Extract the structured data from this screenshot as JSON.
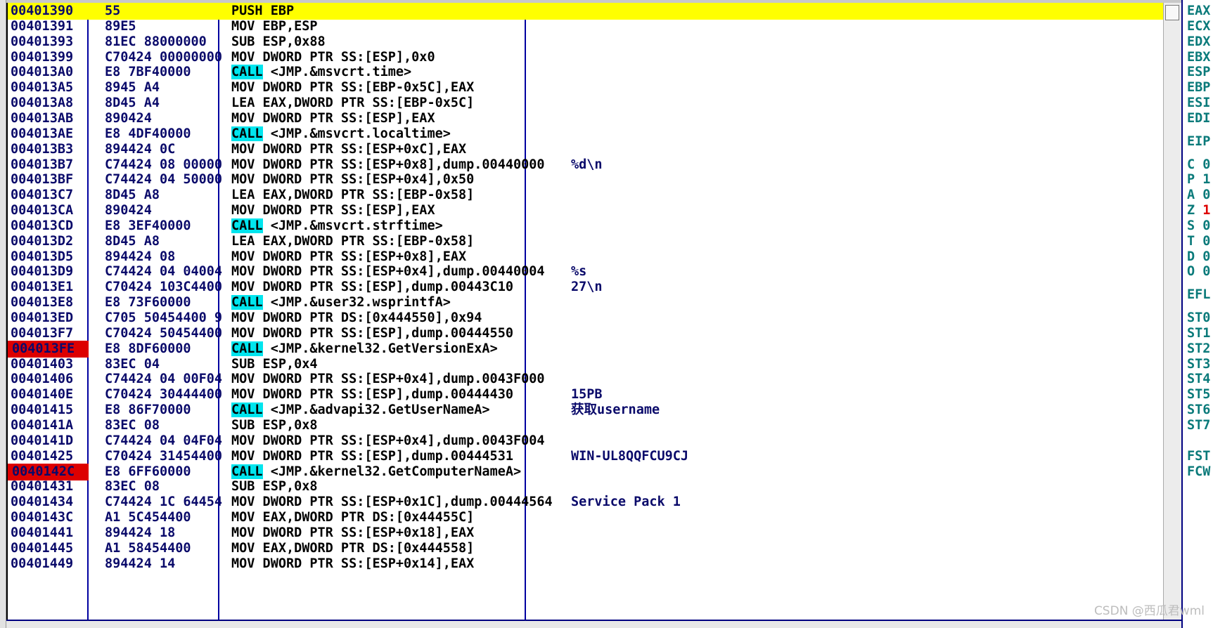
{
  "rows": [
    {
      "addr": "00401390",
      "hex": "55",
      "mnem": "PUSH EBP",
      "args": "",
      "comment": "",
      "selected": true,
      "breakpoint": false
    },
    {
      "addr": "00401391",
      "hex": "89E5",
      "mnem": "MOV EBP,ESP",
      "args": "",
      "comment": ""
    },
    {
      "addr": "00401393",
      "hex": "81EC 88000000",
      "mnem": "SUB ESP,0x88",
      "args": "",
      "comment": ""
    },
    {
      "addr": "00401399",
      "hex": "C70424 00000000",
      "mnem": "MOV DWORD PTR SS:[ESP],0x0",
      "args": "",
      "comment": ""
    },
    {
      "addr": "004013A0",
      "hex": "E8 7BF40000",
      "mnem": "CALL",
      "args": " <JMP.&msvcrt.time>",
      "comment": "",
      "call": true
    },
    {
      "addr": "004013A5",
      "hex": "8945 A4",
      "mnem": "MOV DWORD PTR SS:[EBP-0x5C],EAX",
      "args": "",
      "comment": ""
    },
    {
      "addr": "004013A8",
      "hex": "8D45 A4",
      "mnem": "LEA EAX,DWORD PTR SS:[EBP-0x5C]",
      "args": "",
      "comment": ""
    },
    {
      "addr": "004013AB",
      "hex": "890424",
      "mnem": "MOV DWORD PTR SS:[ESP],EAX",
      "args": "",
      "comment": ""
    },
    {
      "addr": "004013AE",
      "hex": "E8 4DF40000",
      "mnem": "CALL",
      "args": " <JMP.&msvcrt.localtime>",
      "comment": "",
      "call": true
    },
    {
      "addr": "004013B3",
      "hex": "894424 0C",
      "mnem": "MOV DWORD PTR SS:[ESP+0xC],EAX",
      "args": "",
      "comment": ""
    },
    {
      "addr": "004013B7",
      "hex": "C74424 08 00000",
      "mnem": "MOV DWORD PTR SS:[ESP+0x8],dump.00440000",
      "args": "",
      "comment": "%d\\n"
    },
    {
      "addr": "004013BF",
      "hex": "C74424 04 50000",
      "mnem": "MOV DWORD PTR SS:[ESP+0x4],0x50",
      "args": "",
      "comment": ""
    },
    {
      "addr": "004013C7",
      "hex": "8D45 A8",
      "mnem": "LEA EAX,DWORD PTR SS:[EBP-0x58]",
      "args": "",
      "comment": ""
    },
    {
      "addr": "004013CA",
      "hex": "890424",
      "mnem": "MOV DWORD PTR SS:[ESP],EAX",
      "args": "",
      "comment": ""
    },
    {
      "addr": "004013CD",
      "hex": "E8 3EF40000",
      "mnem": "CALL",
      "args": " <JMP.&msvcrt.strftime>",
      "comment": "",
      "call": true
    },
    {
      "addr": "004013D2",
      "hex": "8D45 A8",
      "mnem": "LEA EAX,DWORD PTR SS:[EBP-0x58]",
      "args": "",
      "comment": ""
    },
    {
      "addr": "004013D5",
      "hex": "894424 08",
      "mnem": "MOV DWORD PTR SS:[ESP+0x8],EAX",
      "args": "",
      "comment": ""
    },
    {
      "addr": "004013D9",
      "hex": "C74424 04 04004",
      "mnem": "MOV DWORD PTR SS:[ESP+0x4],dump.00440004",
      "args": "",
      "comment": "%s"
    },
    {
      "addr": "004013E1",
      "hex": "C70424 103C4400",
      "mnem": "MOV DWORD PTR SS:[ESP],dump.00443C10",
      "args": "",
      "comment": "27\\n"
    },
    {
      "addr": "004013E8",
      "hex": "E8 73F60000",
      "mnem": "CALL",
      "args": " <JMP.&user32.wsprintfA>",
      "comment": "",
      "call": true
    },
    {
      "addr": "004013ED",
      "hex": "C705 50454400 9",
      "mnem": "MOV DWORD PTR DS:[0x444550],0x94",
      "args": "",
      "comment": ""
    },
    {
      "addr": "004013F7",
      "hex": "C70424 50454400",
      "mnem": "MOV DWORD PTR SS:[ESP],dump.00444550",
      "args": "",
      "comment": ""
    },
    {
      "addr": "004013FE",
      "hex": "E8 8DF60000",
      "mnem": "CALL",
      "args": " <JMP.&kernel32.GetVersionExA>",
      "comment": "",
      "call": true,
      "breakpoint": true
    },
    {
      "addr": "00401403",
      "hex": "83EC 04",
      "mnem": "SUB ESP,0x4",
      "args": "",
      "comment": ""
    },
    {
      "addr": "00401406",
      "hex": "C74424 04 00F04",
      "mnem": "MOV DWORD PTR SS:[ESP+0x4],dump.0043F000",
      "args": "",
      "comment": ""
    },
    {
      "addr": "0040140E",
      "hex": "C70424 30444400",
      "mnem": "MOV DWORD PTR SS:[ESP],dump.00444430",
      "args": "",
      "comment": "15PB"
    },
    {
      "addr": "00401415",
      "hex": "E8 86F70000",
      "mnem": "CALL",
      "args": " <JMP.&advapi32.GetUserNameA>",
      "comment": "获取username",
      "call": true
    },
    {
      "addr": "0040141A",
      "hex": "83EC 08",
      "mnem": "SUB ESP,0x8",
      "args": "",
      "comment": ""
    },
    {
      "addr": "0040141D",
      "hex": "C74424 04 04F04",
      "mnem": "MOV DWORD PTR SS:[ESP+0x4],dump.0043F004",
      "args": "",
      "comment": ""
    },
    {
      "addr": "00401425",
      "hex": "C70424 31454400",
      "mnem": "MOV DWORD PTR SS:[ESP],dump.00444531",
      "args": "",
      "comment": "WIN-UL8QQFCU9CJ"
    },
    {
      "addr": "0040142C",
      "hex": "E8 6FF60000",
      "mnem": "CALL",
      "args": " <JMP.&kernel32.GetComputerNameA>",
      "comment": "",
      "call": true,
      "breakpoint": true
    },
    {
      "addr": "00401431",
      "hex": "83EC 08",
      "mnem": "SUB ESP,0x8",
      "args": "",
      "comment": ""
    },
    {
      "addr": "00401434",
      "hex": "C74424 1C 64454",
      "mnem": "MOV DWORD PTR SS:[ESP+0x1C],dump.00444564",
      "args": "",
      "comment": "Service Pack 1"
    },
    {
      "addr": "0040143C",
      "hex": "A1 5C454400",
      "mnem": "MOV EAX,DWORD PTR DS:[0x44455C]",
      "args": "",
      "comment": ""
    },
    {
      "addr": "00401441",
      "hex": "894424 18",
      "mnem": "MOV DWORD PTR SS:[ESP+0x18],EAX",
      "args": "",
      "comment": ""
    },
    {
      "addr": "00401445",
      "hex": "A1 58454400",
      "mnem": "MOV EAX,DWORD PTR DS:[0x444558]",
      "args": "",
      "comment": ""
    },
    {
      "addr": "00401449",
      "hex": "894424 14",
      "mnem": "MOV DWORD PTR SS:[ESP+0x14],EAX",
      "args": "",
      "comment": ""
    }
  ],
  "registers": [
    {
      "label": "EAX",
      "row": 0
    },
    {
      "label": "ECX",
      "row": 1
    },
    {
      "label": "EDX",
      "row": 2
    },
    {
      "label": "EBX",
      "row": 3
    },
    {
      "label": "ESP",
      "row": 4
    },
    {
      "label": "EBP",
      "row": 5
    },
    {
      "label": "ESI",
      "row": 6
    },
    {
      "label": "EDI",
      "row": 7
    },
    {
      "label": "EIP",
      "row": 8.5
    },
    {
      "label": "C 0",
      "row": 10
    },
    {
      "label": "P 1",
      "row": 11
    },
    {
      "label": "A 0",
      "row": 12
    },
    {
      "label": "Z 1",
      "row": 13,
      "changed": true
    },
    {
      "label": "S 0",
      "row": 14
    },
    {
      "label": "T 0",
      "row": 15
    },
    {
      "label": "D 0",
      "row": 16
    },
    {
      "label": "O 0",
      "row": 17
    },
    {
      "label": "EFL",
      "row": 18.5
    },
    {
      "label": "ST0",
      "row": 20
    },
    {
      "label": "ST1",
      "row": 21
    },
    {
      "label": "ST2",
      "row": 22
    },
    {
      "label": "ST3",
      "row": 23
    },
    {
      "label": "ST4",
      "row": 24
    },
    {
      "label": "ST5",
      "row": 25
    },
    {
      "label": "ST6",
      "row": 26
    },
    {
      "label": "ST7",
      "row": 27
    },
    {
      "label": "FST",
      "row": 29
    },
    {
      "label": "FCW",
      "row": 30
    }
  ],
  "watermark": "CSDN @西瓜君wml",
  "colors": {
    "selection": "#ffff00",
    "breakpoint": "#dd0000",
    "call_highlight": "#00e5ee",
    "address_text": "#0a0a6a",
    "register_text": "#0a7a7a",
    "divider": "#0000a0"
  }
}
